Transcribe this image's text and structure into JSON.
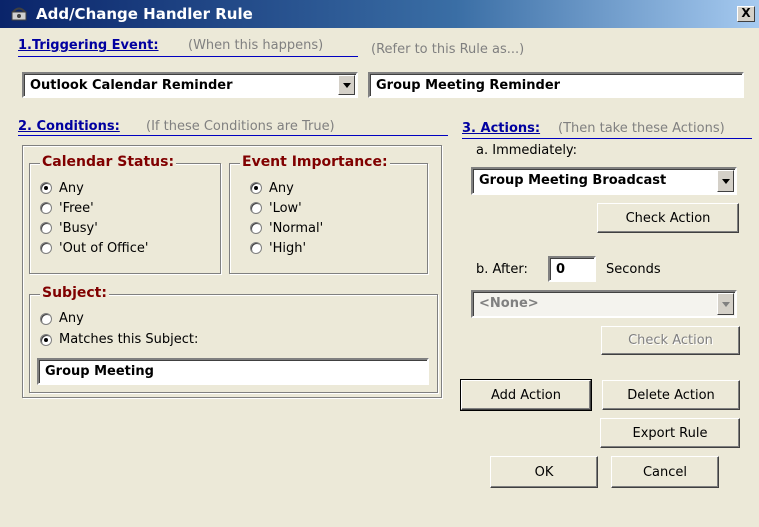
{
  "window": {
    "title": "Add/Change Handler Rule",
    "close": "X"
  },
  "trigger": {
    "heading": "1.Triggering Event:",
    "note": "(When this happens)",
    "selected": "Outlook Calendar Reminder",
    "name_note": "(Refer to this Rule as...)",
    "name_value": "Group Meeting Reminder"
  },
  "conditions": {
    "heading": "2. Conditions:",
    "note": "(If these Conditions are True)",
    "calendar_status": {
      "title": "Calendar Status:",
      "options": [
        "Any",
        "'Free'",
        "'Busy'",
        "'Out of Office'"
      ],
      "selected_index": 0
    },
    "event_importance": {
      "title": "Event Importance:",
      "options": [
        "Any",
        "'Low'",
        "'Normal'",
        "'High'"
      ],
      "selected_index": 0
    },
    "subject": {
      "title": "Subject:",
      "options": [
        "Any",
        "Matches this Subject:"
      ],
      "selected_index": 1,
      "value": "Group Meeting"
    }
  },
  "actions": {
    "heading": "3. Actions:",
    "note": "(Then take these Actions)",
    "immediately_label": "a. Immediately:",
    "immediately_selected": "Group Meeting Broadcast",
    "check_action": "Check Action",
    "after_label": "b. After:",
    "after_value": "0",
    "seconds_label": "Seconds",
    "after_selected": "<None>",
    "check_action_2": "Check Action"
  },
  "buttons": {
    "add_action": "Add Action",
    "delete_action": "Delete Action",
    "export_rule": "Export Rule",
    "ok": "OK",
    "cancel": "Cancel"
  }
}
